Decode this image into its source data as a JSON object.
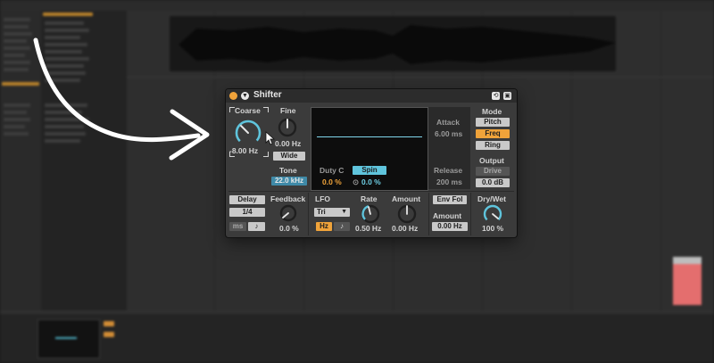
{
  "device": {
    "title": "Shifter",
    "pitch": {
      "coarse_label": "Coarse",
      "coarse_value": "-8.00 Hz",
      "fine_label": "Fine",
      "fine_value": "0.00 Hz",
      "wide_label": "Wide",
      "tone_label": "Tone",
      "tone_value": "22.0 kHz"
    },
    "display": {
      "duty_label": "Duty C",
      "duty_value": "0.0 %",
      "spin_label": "Spin",
      "spin_value": "0.0 %"
    },
    "envelope": {
      "attack_label": "Attack",
      "attack_value": "6.00 ms",
      "release_label": "Release",
      "release_value": "200 ms"
    },
    "mode": {
      "label": "Mode",
      "options": [
        "Pitch",
        "Freq",
        "Ring"
      ],
      "selected": "Freq"
    },
    "output": {
      "label": "Output",
      "drive_label": "Drive",
      "gain_value": "0.0 dB"
    },
    "delay": {
      "delay_label": "Delay",
      "time_value": "1/4",
      "ms_label": "ms",
      "note_glyph": "♪",
      "feedback_label": "Feedback",
      "feedback_value": "0.0 %"
    },
    "lfo": {
      "label": "LFO",
      "waveform": "Tri",
      "hz_label": "Hz",
      "sync_glyph": "♪",
      "rate_label": "Rate",
      "rate_value": "0.50 Hz",
      "amount_label": "Amount",
      "amount_value": "0.00 Hz"
    },
    "env_follow": {
      "label": "Env Fol",
      "amount_label": "Amount",
      "amount_value": "0.00 Hz"
    },
    "drywet": {
      "label": "Dry/Wet",
      "value": "100 %"
    }
  },
  "colors": {
    "accent_orange": "#f0a33a",
    "accent_cyan": "#5fc4dc",
    "panel": "#3b3b3b",
    "display_bg": "#0d0d0d",
    "background_red_clip": "#e46e6e"
  },
  "icons": [
    "power-icon",
    "fold-icon",
    "hot-swap-icon",
    "save-preset-icon",
    "mouse-cursor-icon",
    "arrow-annotation"
  ]
}
